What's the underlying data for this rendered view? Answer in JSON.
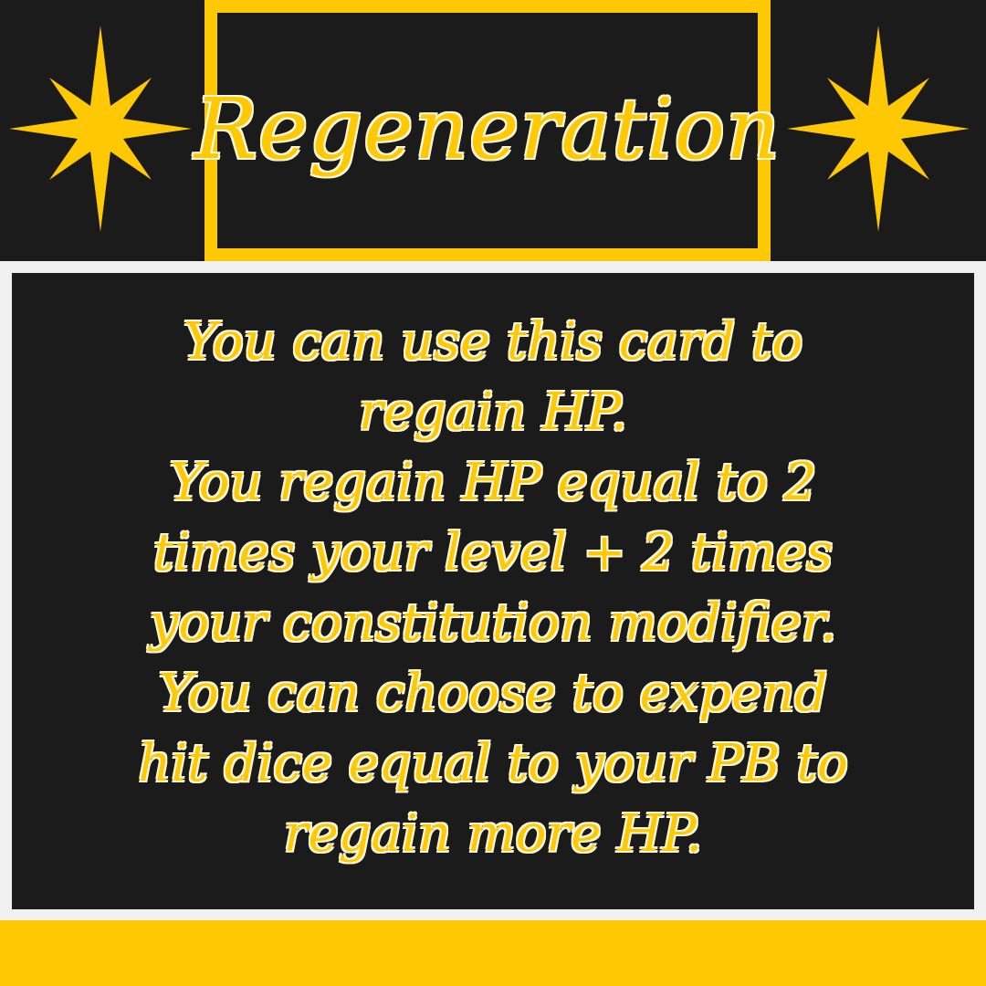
{
  "card": {
    "title": "Regeneration",
    "description_lines": [
      "You can use this card to",
      "regain HP.",
      "You regain HP equal to 2",
      "times your level + 2 times",
      "your constitution modifier.",
      "You can choose to expend",
      "hit dice equal to your PB to",
      "regain more HP."
    ]
  },
  "colors": {
    "accent": "#fec802",
    "background": "#1c1b1b",
    "outline": "#fff8dc",
    "page": "#f0f0f0"
  },
  "icons": {
    "left": "eight-point-star-icon",
    "right": "eight-point-star-icon"
  }
}
